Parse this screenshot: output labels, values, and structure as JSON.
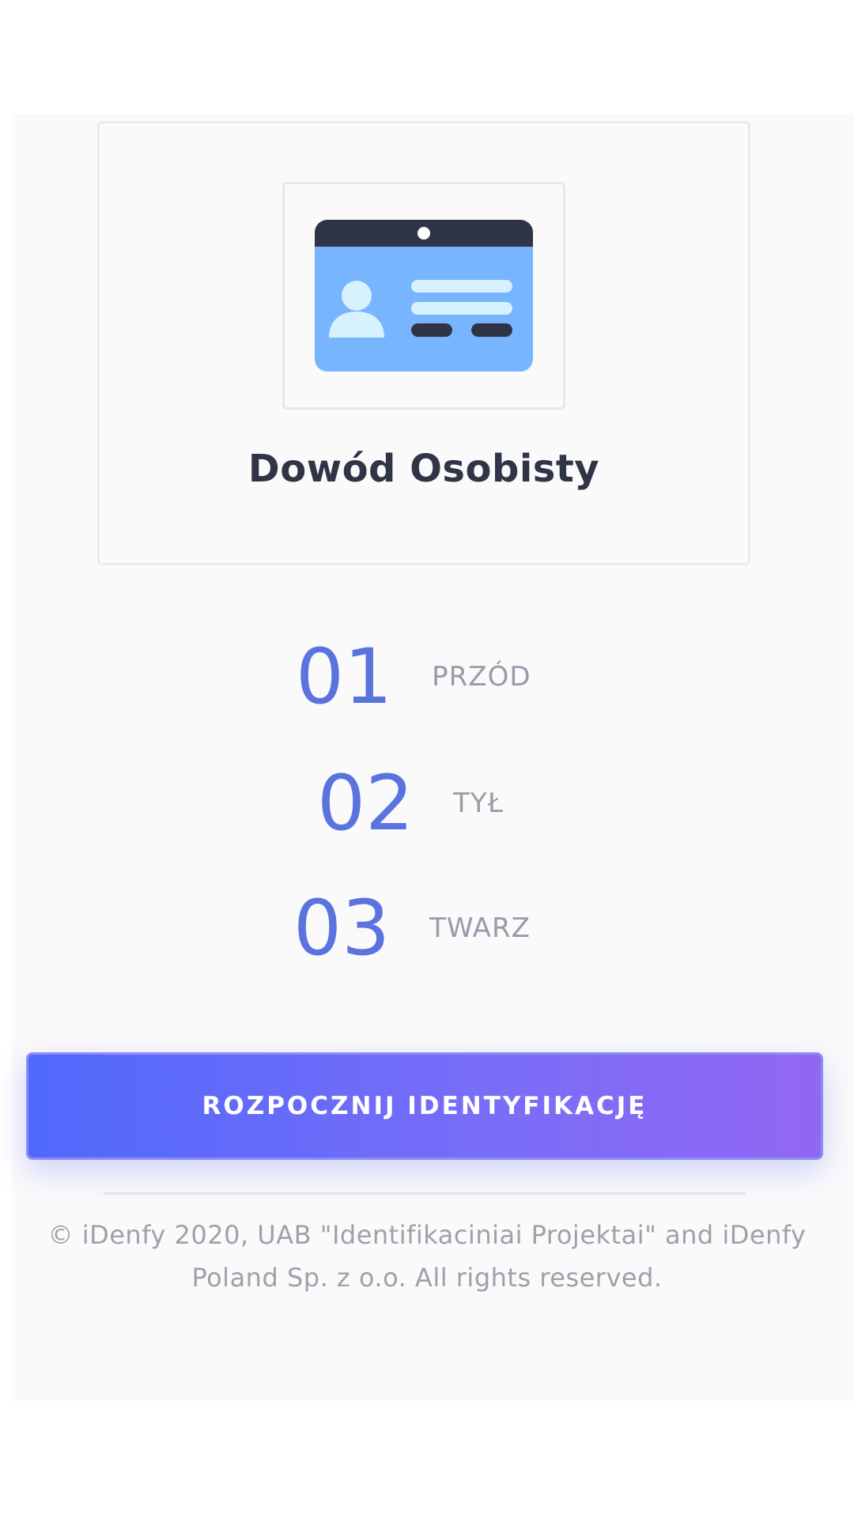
{
  "document": {
    "title": "Dowód Osobisty",
    "icon": "id-card-icon"
  },
  "steps": [
    {
      "number": "01",
      "label": "PRZÓD"
    },
    {
      "number": "02",
      "label": "TYŁ"
    },
    {
      "number": "03",
      "label": "TWARZ"
    }
  ],
  "start_button": {
    "label": "ROZPOCZNIJ IDENTYFIKACJĘ"
  },
  "footer": {
    "line1": "© iDenfy 2020, UAB \"Identifikaciniai Projektai\" and iDenfy",
    "line2": "Poland Sp. z o.o. All rights reserved."
  },
  "colors": {
    "accent": "#5b73de",
    "button_gradient_start": "#5069fb",
    "button_gradient_end": "#9267f2",
    "card_blue": "#77b6ff",
    "card_dark": "#303447"
  }
}
